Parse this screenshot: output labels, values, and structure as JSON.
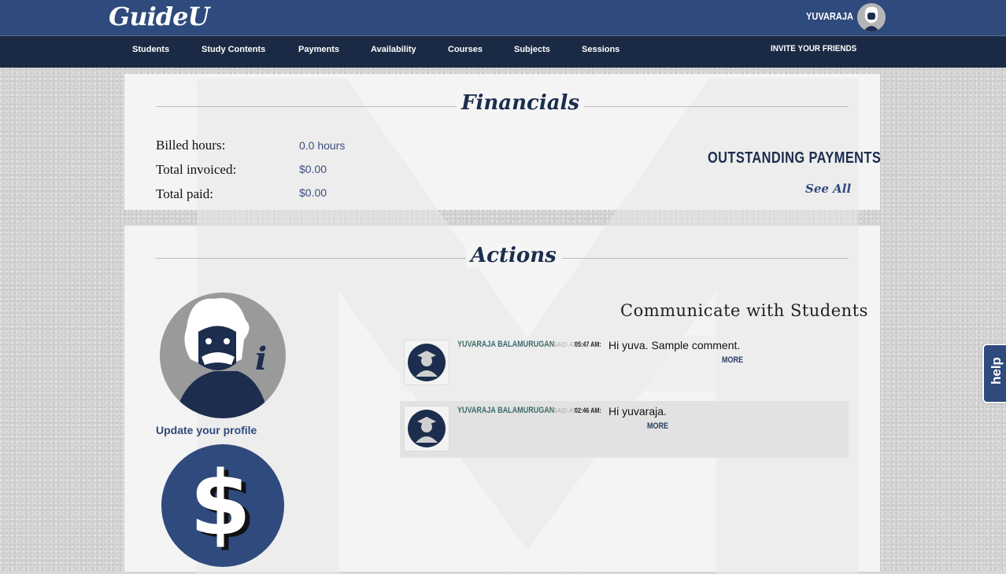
{
  "header": {
    "logo": "GuideU",
    "username": "YUVARAJA"
  },
  "nav": {
    "items": [
      "Students",
      "Study Contents",
      "Payments",
      "Availability",
      "Courses",
      "Subjects",
      "Sessions"
    ],
    "invite": "INVITE YOUR FRIENDS"
  },
  "financials": {
    "title": "Financials",
    "billed_label": "Billed hours:",
    "billed_value": "0.0 hours",
    "invoiced_label": "Total invoiced:",
    "invoiced_value": "$0.00",
    "paid_label": "Total paid:",
    "paid_value": "$0.00",
    "outstanding_title": "OUTSTANDING PAYMENTS",
    "see_all": "See All"
  },
  "actions": {
    "title": "Actions",
    "update_profile": "Update your profile",
    "communicate_title": "Communicate with Students",
    "messages": [
      {
        "name": "YUVARAJA BALAMURUGAN",
        "said_at": "SAID AT",
        "time": "05:47 AM:",
        "text": "Hi yuva. Sample comment.",
        "more": "MORE"
      },
      {
        "name": "YUVARAJA BALAMURUGAN",
        "said_at": "SAID AT",
        "time": "02:46 AM:",
        "text": "Hi yuvaraja.",
        "more": "MORE"
      }
    ]
  },
  "help": {
    "label": "help"
  },
  "colors": {
    "brand": "#2f4a7c",
    "nav": "#1b2a44",
    "title": "#1c2d4e"
  }
}
